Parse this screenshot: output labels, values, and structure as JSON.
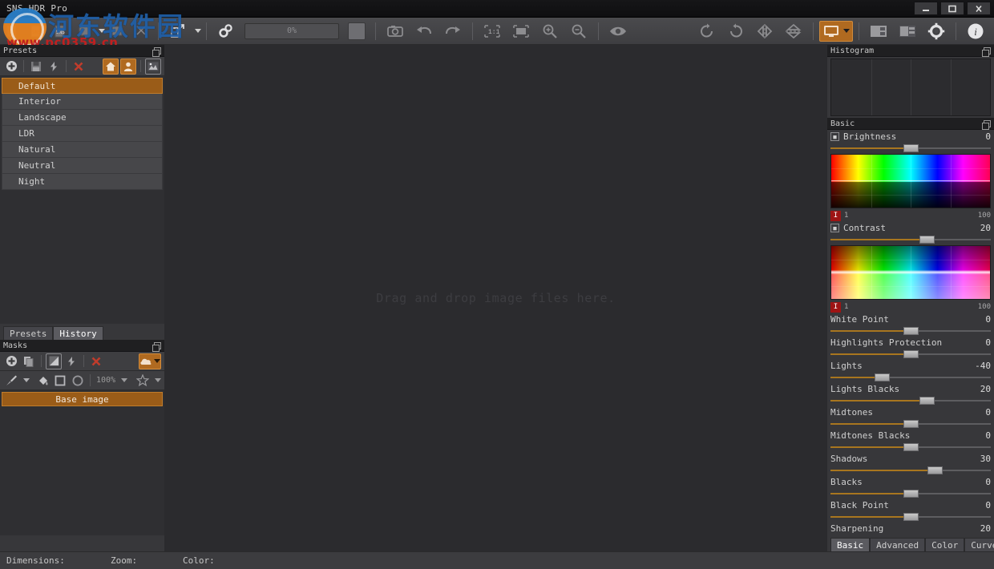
{
  "window": {
    "title": "SNS-HDR Pro",
    "minimize_label": "minimize",
    "maximize_label": "maximize",
    "close_label": "close"
  },
  "watermark": {
    "chinese": "河东软件园",
    "url": "www.pc0359.cn"
  },
  "toolbar": {
    "progress_value": "0%",
    "icons": [
      "open-file-icon",
      "open-sns-icon",
      "save-sns-icon",
      "batch-icon",
      "align-icon",
      "export-icon",
      "export-dropdown-icon",
      "settings-gears-icon",
      "stop-icon",
      "camera-icon",
      "undo-icon",
      "redo-icon",
      "zoom-actual-icon",
      "zoom-fit-icon",
      "zoom-in-icon",
      "zoom-out-icon",
      "preview-eye-icon",
      "rotate-cw-icon",
      "rotate-ccw-icon",
      "flip-horizontal-icon",
      "flip-vertical-icon",
      "display-mode-icon",
      "display-mode-dropdown-icon",
      "layout-left-icon",
      "layout-right-icon",
      "gear-icon",
      "info-icon"
    ]
  },
  "presets_panel": {
    "title": "Presets",
    "tools": [
      "add-preset-icon",
      "save-preset-icon",
      "refresh-preset-icon",
      "delete-preset-icon",
      "home-presets-icon",
      "user-presets-icon",
      "image-presets-icon"
    ],
    "items": [
      {
        "label": "Default",
        "selected": true
      },
      {
        "label": "Interior",
        "selected": false
      },
      {
        "label": "Landscape",
        "selected": false
      },
      {
        "label": "LDR",
        "selected": false
      },
      {
        "label": "Natural",
        "selected": false
      },
      {
        "label": "Neutral",
        "selected": false
      },
      {
        "label": "Night",
        "selected": false
      }
    ]
  },
  "left_tabs": [
    {
      "label": "Presets",
      "active": false
    },
    {
      "label": "History",
      "active": true
    }
  ],
  "masks_panel": {
    "title": "Masks",
    "row1_icons": [
      "add-mask-icon",
      "duplicate-mask-icon",
      "invert-mask-icon",
      "refresh-mask-icon",
      "delete-mask-icon",
      "cloud-mask-icon",
      "cloud-dropdown-icon"
    ],
    "row2_icons": [
      "brush-icon",
      "brush-dropdown-icon",
      "fill-icon",
      "rectangle-select-icon",
      "ellipse-select-icon",
      "opacity-dropdown-icon",
      "star-icon",
      "star-dropdown-icon"
    ],
    "opacity_value": "100%",
    "items": [
      {
        "label": "Base image",
        "selected": true
      }
    ]
  },
  "canvas": {
    "drop_hint": "Drag and drop image files here."
  },
  "histogram_panel": {
    "title": "Histogram"
  },
  "basic_panel": {
    "title": "Basic",
    "brightness": {
      "label": "Brightness",
      "value": "0",
      "knob_pct": 50,
      "icon": "reset-brightness-icon"
    },
    "hue_range_1": {
      "badge": "I",
      "low": "1",
      "high": "100"
    },
    "contrast": {
      "label": "Contrast",
      "value": "20",
      "knob_pct": 60,
      "icon": "reset-contrast-icon"
    },
    "hue_range_2": {
      "badge": "I",
      "low": "1",
      "high": "100"
    },
    "sliders": [
      {
        "label": "White Point",
        "value": "0",
        "knob_pct": 50
      },
      {
        "label": "Highlights Protection",
        "value": "0",
        "knob_pct": 50
      },
      {
        "label": "Lights",
        "value": "-40",
        "knob_pct": 32
      },
      {
        "label": "Lights Blacks",
        "value": "20",
        "knob_pct": 60
      },
      {
        "label": "Midtones",
        "value": "0",
        "knob_pct": 50
      },
      {
        "label": "Midtones Blacks",
        "value": "0",
        "knob_pct": 50
      },
      {
        "label": "Shadows",
        "value": "30",
        "knob_pct": 65
      },
      {
        "label": "Blacks",
        "value": "0",
        "knob_pct": 50
      },
      {
        "label": "Black Point",
        "value": "0",
        "knob_pct": 50
      },
      {
        "label": "Sharpening",
        "value": "20",
        "knob_pct": 60
      }
    ]
  },
  "right_tabs": [
    {
      "label": "Basic",
      "active": true
    },
    {
      "label": "Advanced",
      "active": false
    },
    {
      "label": "Color",
      "active": false
    },
    {
      "label": "Curves",
      "active": false
    }
  ],
  "statusbar": {
    "dimensions_label": "Dimensions:",
    "zoom_label": "Zoom:",
    "color_label": "Color:"
  },
  "colors": {
    "accent_orange": "#b06a20",
    "selection_orange": "#9a5c18",
    "slider_fill": "#a8761f",
    "panel_bg": "#37373a",
    "canvas_bg": "#2b2b2e",
    "badge_red": "#9e1414"
  }
}
